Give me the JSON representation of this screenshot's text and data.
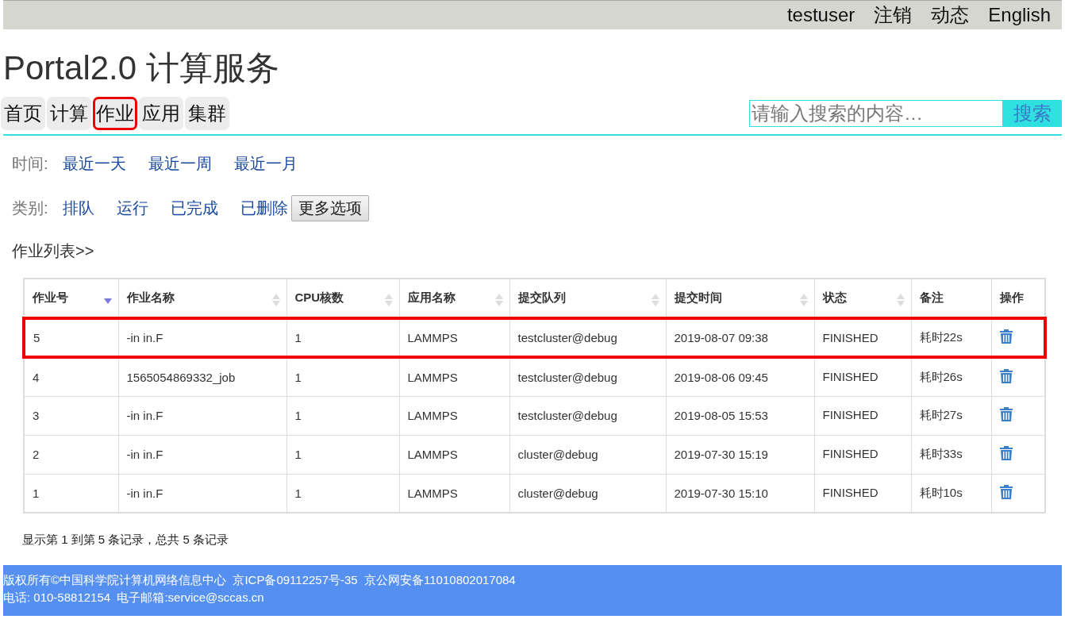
{
  "top_bar": {
    "items": [
      "testuser",
      "注销",
      "动态",
      "English"
    ]
  },
  "title": "Portal2.0 计算服务",
  "nav": [
    {
      "label": "首页",
      "highlighted": false
    },
    {
      "label": "计算",
      "highlighted": false
    },
    {
      "label": "作业",
      "highlighted": true
    },
    {
      "label": "应用",
      "highlighted": false
    },
    {
      "label": "集群",
      "highlighted": false
    }
  ],
  "search": {
    "placeholder": "请输入搜索的内容…",
    "button": "搜索"
  },
  "filters": [
    {
      "label": "时间:",
      "options": [
        "最近一天",
        "最近一周",
        "最近一月"
      ]
    },
    {
      "label": "类别:",
      "options": [
        "排队",
        "运行",
        "已完成",
        "已删除"
      ],
      "button": "更多选项"
    }
  ],
  "list_heading": "作业列表>>",
  "table": {
    "columns": [
      {
        "label": "作业号",
        "sortable": true,
        "sorted": true
      },
      {
        "label": "作业名称",
        "sortable": true,
        "sorted": false
      },
      {
        "label": "CPU核数",
        "sortable": true,
        "sorted": false
      },
      {
        "label": "应用名称",
        "sortable": true,
        "sorted": false
      },
      {
        "label": "提交队列",
        "sortable": true,
        "sorted": false
      },
      {
        "label": "提交时间",
        "sortable": true,
        "sorted": false
      },
      {
        "label": "状态",
        "sortable": true,
        "sorted": false
      },
      {
        "label": "备注",
        "sortable": false
      },
      {
        "label": "操作",
        "sortable": false
      }
    ],
    "rows": [
      {
        "cells": [
          "5",
          "-in in.F",
          "1",
          "LAMMPS",
          "testcluster@debug",
          "2019-08-07 09:38",
          "FINISHED",
          "耗时22s"
        ],
        "highlighted": true
      },
      {
        "cells": [
          "4",
          "1565054869332_job",
          "1",
          "LAMMPS",
          "testcluster@debug",
          "2019-08-06 09:45",
          "FINISHED",
          "耗时26s"
        ],
        "highlighted": false
      },
      {
        "cells": [
          "3",
          "-in in.F",
          "1",
          "LAMMPS",
          "testcluster@debug",
          "2019-08-05 15:53",
          "FINISHED",
          "耗时27s"
        ],
        "highlighted": false
      },
      {
        "cells": [
          "2",
          "-in in.F",
          "1",
          "LAMMPS",
          "cluster@debug",
          "2019-07-30 15:19",
          "FINISHED",
          "耗时33s"
        ],
        "highlighted": false
      },
      {
        "cells": [
          "1",
          "-in in.F",
          "1",
          "LAMMPS",
          "cluster@debug",
          "2019-07-30 15:10",
          "FINISHED",
          "耗时10s"
        ],
        "highlighted": false
      }
    ]
  },
  "pagination_info": "显示第 1 到第 5 条记录，总共 5 条记录",
  "footer": {
    "lines": [
      "版权所有©中国科学院计算机网络信息中心  京ICP备09112257号-35  京公网安备11010802017084",
      "电话: 010-58812154  电子邮箱:service@sccas.cn"
    ]
  }
}
